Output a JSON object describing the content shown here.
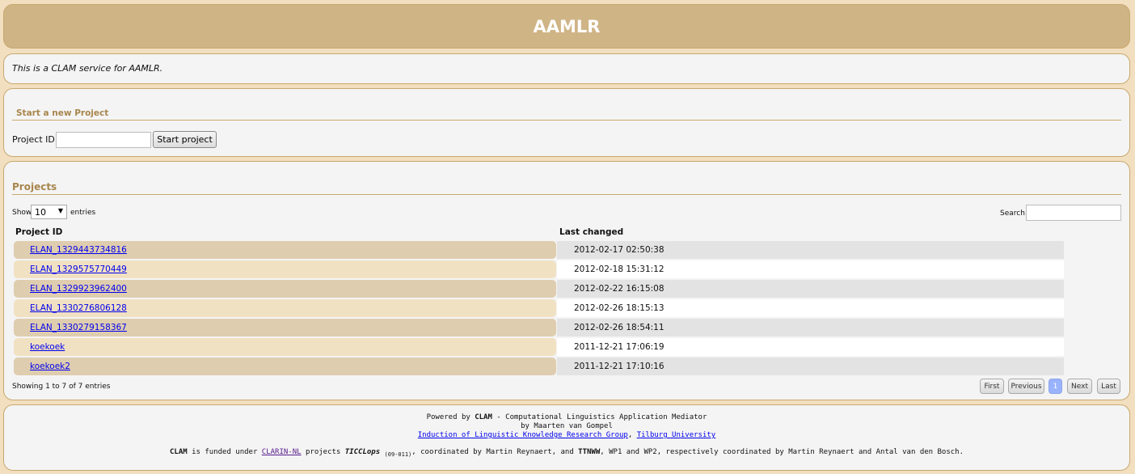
{
  "header": {
    "title": "AAMLR"
  },
  "description": "This is a CLAM service for AAMLR.",
  "start": {
    "heading": "Start a new Project",
    "project_id_label": "Project ID:",
    "project_id_value": "",
    "button_label": "Start project"
  },
  "projects": {
    "heading": "Projects",
    "show_label": "Show",
    "page_size": "10",
    "entries_label": "entries",
    "search_label": "Search:",
    "search_value": "",
    "columns": [
      "Project ID",
      "Last changed"
    ],
    "rows": [
      {
        "id": "ELAN_1329443734816",
        "changed": "2012-02-17 02:50:38"
      },
      {
        "id": "ELAN_1329575770449",
        "changed": "2012-02-18 15:31:12"
      },
      {
        "id": "ELAN_1329923962400",
        "changed": "2012-02-22 16:15:08"
      },
      {
        "id": "ELAN_1330276806128",
        "changed": "2012-02-26 18:15:13"
      },
      {
        "id": "ELAN_1330279158367",
        "changed": "2012-02-26 18:54:11"
      },
      {
        "id": "koekoek",
        "changed": "2011-12-21 17:06:19"
      },
      {
        "id": "koekoek2",
        "changed": "2011-12-21 17:10:16"
      }
    ],
    "info": "Showing 1 to 7 of 7 entries",
    "pagination": {
      "first": "First",
      "previous": "Previous",
      "current": "1",
      "next": "Next",
      "last": "Last"
    }
  },
  "footer": {
    "powered_prefix": "Powered by ",
    "clam": "CLAM",
    "powered_suffix": " - Computational Linguistics Application Mediator",
    "by_line": "by Maarten van Gompel",
    "group_link": "Induction of Linguistic Knowledge Research Group",
    "separator": ", ",
    "university_link": "Tilburg University",
    "funded_prefix": " is funded under ",
    "clarin_link": "CLARIN-NL",
    "projects_text": " projects ",
    "ticclops": "TICCLops",
    "ticclops_code": "(09-011)",
    "coordinated_text": ", coordinated by Martin Reynaert, and ",
    "ttnww": "TTNWW",
    "funded_suffix": ", WP1 and WP2, respectively coordinated by Martin Reynaert and Antal van den Bosch."
  },
  "colors": {
    "header_bg": "#cfb486",
    "page_bg": "#f2dfc0",
    "panel_bg": "#f4f4f4",
    "heading_text": "#a8864d",
    "row_id_odd": "#dfcdaf",
    "row_id_even": "#f1e1c3",
    "row_date_odd": "#e3e3e3",
    "row_date_even": "#ffffff",
    "pager_active": "#99b3ff",
    "link": "#0000ee"
  },
  "icons": {
    "page_size_dropdown": "chevron-down-icon"
  }
}
